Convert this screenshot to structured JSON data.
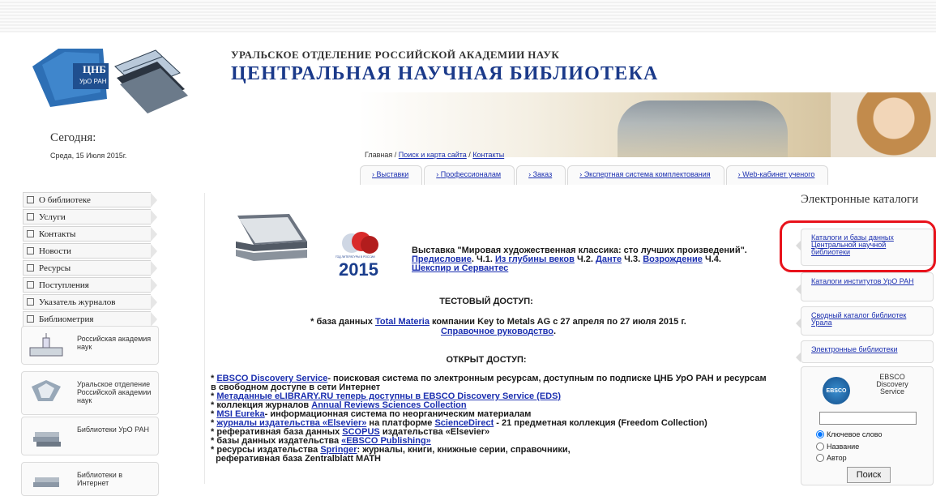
{
  "header": {
    "org_name": "УРАЛЬСКОЕ ОТДЕЛЕНИЕ РОССИЙСКОЙ АКАДЕМИИ НАУК",
    "library_name": "ЦЕНТРАЛЬНАЯ НАУЧНАЯ БИБЛИОТЕКА",
    "logo_text1": "ЦНБ",
    "logo_text2": "УрО РАН"
  },
  "today": {
    "label": "Сегодня:",
    "date": "Среда, 15 Июля 2015г."
  },
  "breadcrumbs": {
    "home": "Главная",
    "sep": " / ",
    "search": "Поиск и карта сайта",
    "contacts": "Контакты"
  },
  "topnav": [
    "Выставки",
    "Профессионалам",
    "Заказ",
    "Экспертная система комплектования",
    "Web-кабинет ученого"
  ],
  "leftnav": [
    "О библиотеке",
    "Услуги",
    "Контакты",
    "Новости",
    "Ресурсы",
    "Поступления",
    "Указатель журналов",
    "Библиометрия"
  ],
  "partners": [
    "Российская академия наук",
    "Уральское отделение Российской академии наук",
    "Библиотеки УрО РАН",
    "Библиотеки в Интернет"
  ],
  "exhibition": {
    "year": "2015",
    "logo_caption": "ГОД ЛИТЕРАТУРЫ В РОССИИ",
    "intro": "Выставка \"Мировая художественная классика: сто лучших произведений\".",
    "preface": "Предисловие",
    "p1_prefix": "Ч.1.",
    "p1": "Из глубины веков",
    "p2_prefix": "Ч.2.",
    "p2": "Данте",
    "p3_prefix": "Ч.3.",
    "p3": "Возрождение",
    "p4_prefix": "Ч.4.",
    "p4": "Шекспир и Сервантес"
  },
  "test_access": {
    "title": "ТЕСТОВЫЙ ДОСТУП:",
    "pre": "* база данных",
    "link": "Total Materia",
    "post": "компании Key to Metals AG с 27 апреля по 27 июля 2015 г.",
    "guide": "Справочное руководство"
  },
  "open_access": {
    "title": "ОТКРЫТ ДОСТУП:",
    "l1_link": "EBSCO Discovery Service",
    "l1_text": "- поисковая система по электронным ресурсам, доступным по подписке ЦНБ УрО РАН и ресурсам в свободном доступе в сети Интернет",
    "l2_link": "Метаданные eLIBRARY.RU теперь доступны в EBSCO Discovery Service (EDS)",
    "l3_text": "коллекция журналов",
    "l3_link": "Annual Reviews Sciences Collection",
    "l4_link": "MSI Eureka",
    "l4_text": "- информационная система по неорганическим материалам",
    "l5_link": "журналы издательства «Elsevier»",
    "l5_text": "на платформе",
    "l5_link2": "ScienceDirect",
    "l5_text2": "- 21 предметная коллекция (Freedom Collection)",
    "l6_text": "реферативная база данных",
    "l6_link": "SCOPUS",
    "l6_text2": "издательства «Elsevier»",
    "l7_text": "базы данных издательства",
    "l7_link": "«EBSCO Publishing»",
    "l8_text": "ресурсы издательства",
    "l8_link": "Springer",
    "l8_text2": ": журналы, книги, книжные серии, справочники,",
    "l9_text": "реферативная база Zentralblatt MATH"
  },
  "right": {
    "heading": "Электронные каталоги",
    "links": [
      "Каталоги и базы данных Центральной научной библиотеки",
      "Каталоги институтов УрО РАН",
      "Сводный каталог библиотек Урала",
      "Электронные библиотеки"
    ],
    "ebsco": {
      "logo": "EBSCO",
      "title": "EBSCO Discovery Service",
      "input_value": "",
      "options": [
        "Ключевое слово",
        "Название",
        "Автор"
      ],
      "button": "Поиск"
    }
  },
  "colors": {
    "link": "#1b2fb0",
    "title": "#1b3a8a",
    "highlight": "#e8121b"
  }
}
